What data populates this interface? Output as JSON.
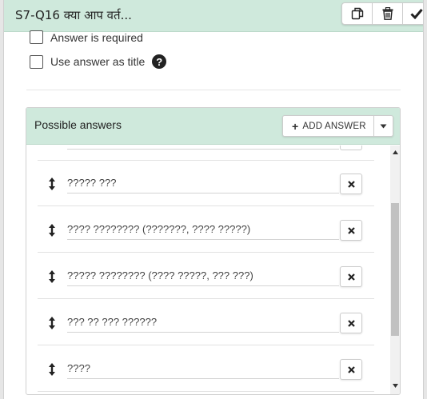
{
  "header": {
    "title": "S7-Q16 क्या आप वर्त...",
    "actions": [
      {
        "name": "duplicate-button",
        "icon": "copy-icon"
      },
      {
        "name": "delete-button",
        "icon": "trash-icon"
      },
      {
        "name": "confirm-button",
        "icon": "check-icon"
      }
    ]
  },
  "options": {
    "required_label": "Answer is required",
    "use_as_title_label": "Use answer as title",
    "help_glyph": "?"
  },
  "possible_answers": {
    "title": "Possible answers",
    "add_button_label": "ADD ANSWER",
    "items": [
      {
        "text": "????? ???"
      },
      {
        "text": "???? ???????? (???????, ???? ?????)"
      },
      {
        "text": "????? ???????? (???? ?????, ??? ???)"
      },
      {
        "text": "??? ?? ??? ??????"
      },
      {
        "text": "????"
      }
    ]
  },
  "colors": {
    "header_bg": "#cfe9dc",
    "panel_bg": "#ffffff",
    "scroll_thumb": "#c1c1c1"
  }
}
